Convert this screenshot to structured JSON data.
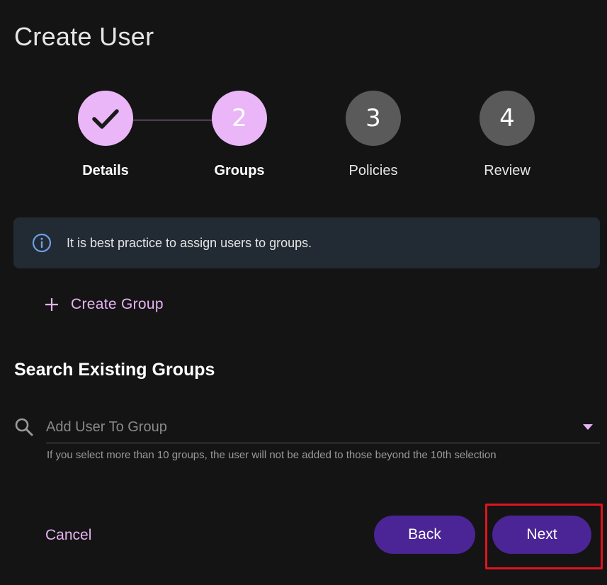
{
  "page": {
    "title": "Create User"
  },
  "stepper": {
    "steps": [
      {
        "number": "",
        "label": "Details",
        "state": "complete"
      },
      {
        "number": "2",
        "label": "Groups",
        "state": "active"
      },
      {
        "number": "3",
        "label": "Policies",
        "state": "pending"
      },
      {
        "number": "4",
        "label": "Review",
        "state": "pending"
      }
    ]
  },
  "info_banner": {
    "icon": "info-icon",
    "text": "It is best practice to assign users to groups."
  },
  "create_group": {
    "icon": "plus-icon",
    "label": "Create Group"
  },
  "search_section": {
    "heading": "Search Existing Groups",
    "search_icon": "search-icon",
    "placeholder": "Add User To Group",
    "value": "",
    "helper_text": "If you select more than 10 groups, the user will not be added to those beyond the 10th selection"
  },
  "footer": {
    "cancel_label": "Cancel",
    "back_label": "Back",
    "next_label": "Next"
  },
  "colors": {
    "background": "#141414",
    "accent": "#eab6f8",
    "link": "#e6b3f5",
    "primary_button": "#4b2596",
    "pending_step": "#5a5a5a",
    "banner_bg": "#222a33",
    "highlight": "#e0141e"
  }
}
